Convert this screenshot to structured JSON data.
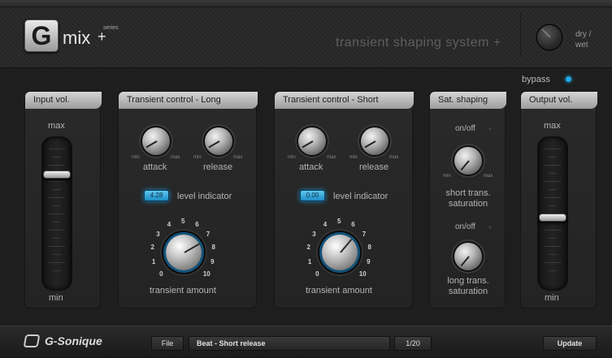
{
  "header": {
    "logo_letter": "G",
    "logo_name": "mix",
    "logo_plus": "+",
    "logo_series": "series",
    "product_title": "transient shaping system +",
    "drywet_label_1": "dry /",
    "drywet_label_2": "wet",
    "drywet_icon": "dry-wet-knob"
  },
  "bypass": {
    "label": "bypass",
    "led_color": "#1ea8e8",
    "active": true
  },
  "panels": {
    "input_vol": {
      "title": "Input vol.",
      "max_label": "max",
      "min_label": "min",
      "level": 0.78
    },
    "transient_long": {
      "title": "Transient control - Long",
      "attack_label": "attack",
      "release_label": "release",
      "min_label": "min",
      "max_label": "max",
      "level_value": "4.28",
      "level_label": "level indicator",
      "amount_label": "transient amount",
      "scale": [
        "0",
        "1",
        "2",
        "3",
        "4",
        "5",
        "6",
        "7",
        "8",
        "9",
        "10"
      ]
    },
    "transient_short": {
      "title": "Transient control - Short",
      "attack_label": "attack",
      "release_label": "release",
      "min_label": "min",
      "max_label": "max",
      "level_value": "0.00",
      "level_label": "level indicator",
      "amount_label": "transient amount",
      "scale": [
        "0",
        "1",
        "2",
        "3",
        "4",
        "5",
        "6",
        "7",
        "8",
        "9",
        "10"
      ]
    },
    "sat_shaping": {
      "title": "Sat. shaping",
      "onoff_label_1": "on/off",
      "onoff_label_2": "on/off",
      "short_label_1": "short trans.",
      "short_label_2": "saturation",
      "long_label_1": "long trans.",
      "long_label_2": "saturation",
      "min_label": "min",
      "max_label": "max"
    },
    "output_vol": {
      "title": "Output vol.",
      "max_label": "max",
      "min_label": "min",
      "level": 0.47
    }
  },
  "footer": {
    "brand": "G-Sonique",
    "file_label": "File",
    "preset_name": "Beat - Short release",
    "preset_counter": "1/20",
    "update_label": "Update"
  },
  "colors": {
    "accent": "#1ea8e8",
    "panel_title": "#c0c0c0",
    "background": "#1e1e1e"
  }
}
